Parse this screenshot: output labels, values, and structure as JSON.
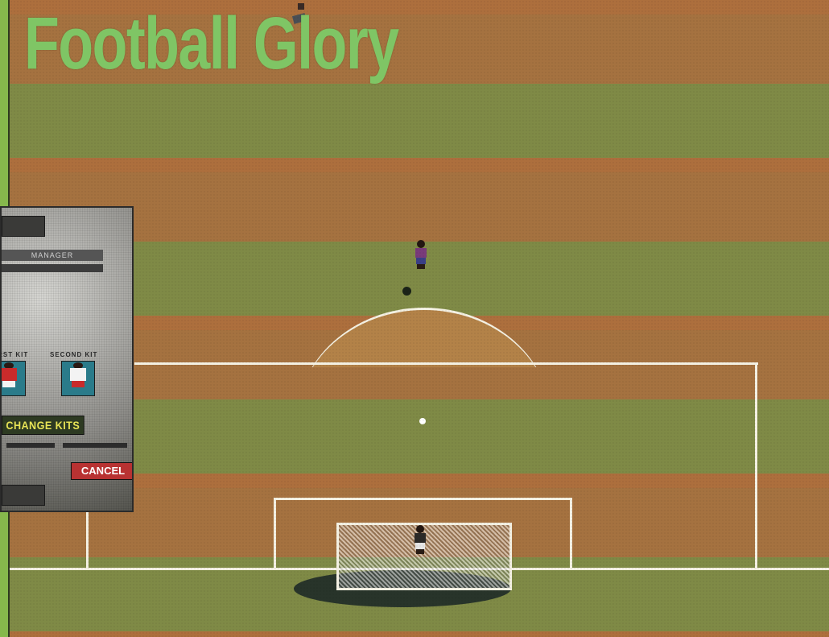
{
  "game": {
    "title": "Football Glory"
  },
  "menu": {
    "manager_label": "MANAGER",
    "first_kit_label": "FIRST KIT",
    "second_kit_label": "SECOND KIT",
    "change_kits_label": "CHANGE KITS",
    "cancel_label": "CANCEL"
  },
  "colors": {
    "title_green": "#7fc565",
    "pitch_brown": "#a7723d",
    "pitch_green": "#7f8a43",
    "line_white": "#f4f1e2",
    "kit_red": "#c92b2b",
    "cancel_red": "#b83232",
    "change_kits_yellow": "#e7e356"
  }
}
